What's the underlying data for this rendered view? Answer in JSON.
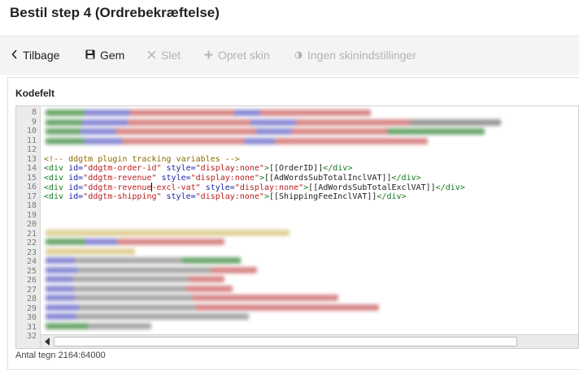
{
  "header": {
    "title": "Bestil step 4 (Ordrebekræftelse)"
  },
  "toolbar": {
    "back": {
      "label": "Tilbage",
      "icon": "chevron-left-icon"
    },
    "save": {
      "label": "Gem",
      "icon": "floppy-disk-icon"
    },
    "delete": {
      "label": "Slet",
      "icon": "close-icon"
    },
    "create_skin": {
      "label": "Opret skin",
      "icon": "plus-icon"
    },
    "no_skin_settings": {
      "label": "Ingen skinindstillinger",
      "icon": "half-circle-icon"
    }
  },
  "panel": {
    "label": "Kodefelt"
  },
  "editor": {
    "line_numbers": [
      "8",
      "9",
      "10",
      "11",
      "12",
      "13",
      "14",
      "15",
      "16",
      "17",
      "18",
      "19",
      "20",
      "21",
      "22",
      "23",
      "24",
      "25",
      "26",
      "27",
      "28",
      "29",
      "30",
      "31",
      "32"
    ],
    "comment_line": "<!-- ddgtm plugin tracking variables -->",
    "lines": [
      {
        "tag_open": "<div ",
        "attr1": "id=",
        "val1": "\"ddgtm-order-id\"",
        "attr2": " style=",
        "val2": "\"display:none\"",
        "gt": ">",
        "text": "[[OrderID]]",
        "tag_close": "</div>"
      },
      {
        "tag_open": "<div ",
        "attr1": "id=",
        "val1": "\"ddgtm-revenue\"",
        "attr2": " style=",
        "val2": "\"display:none\"",
        "gt": ">",
        "text": "[[AdWordsSubTotalInclVAT]]",
        "tag_close": "</div>"
      },
      {
        "tag_open": "<div ",
        "attr1": "id=",
        "val1a": "\"ddgtm-revenue",
        "val1b": "-excl-vat\"",
        "attr2": " style=",
        "val2": "\"display:none\"",
        "gt": ">",
        "text": "[[AdWordsSubTotalExclVAT]]",
        "tag_close": "</div>"
      },
      {
        "tag_open": "<div ",
        "attr1": "id=",
        "val1": "\"ddgtm-shipping\"",
        "attr2": " style=",
        "val2": "\"display:none\"",
        "gt": ">",
        "text": "[[ShippingFeeInclVAT]]",
        "tag_close": "</div>"
      }
    ]
  },
  "footer": {
    "char_count": "Antal tegn 2164:64000"
  },
  "colors": {
    "comment": "#8e6b00",
    "tag": "#13771f",
    "attribute": "#1a27a6",
    "value": "#b81d1d",
    "toolbar_bg": "#f4f4f4",
    "gutter_bg": "#ebebeb"
  }
}
